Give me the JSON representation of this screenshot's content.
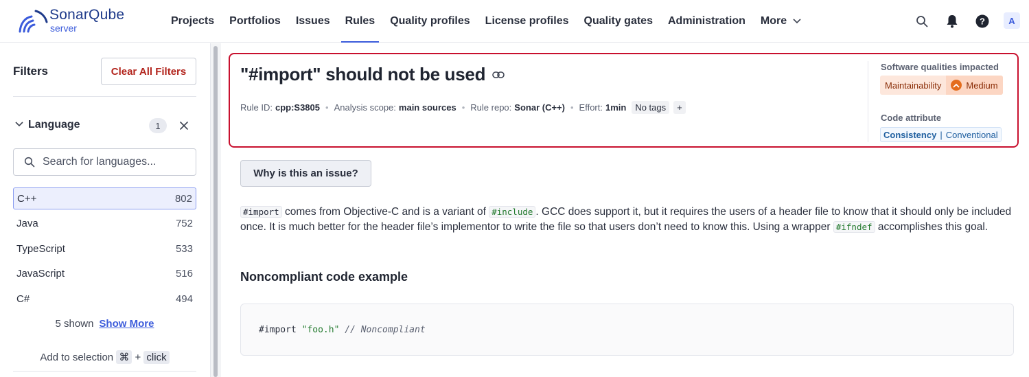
{
  "logo": {
    "name": "SonarQube",
    "subtitle": "server"
  },
  "nav": {
    "items": [
      "Projects",
      "Portfolios",
      "Issues",
      "Rules",
      "Quality profiles",
      "License profiles",
      "Quality gates",
      "Administration",
      "More"
    ],
    "active": "Rules"
  },
  "top_icons": [
    "search-icon",
    "bell-icon",
    "help-icon"
  ],
  "avatar": "A",
  "sidebar": {
    "title": "Filters",
    "clear_all": "Clear All Filters",
    "language": {
      "title": "Language",
      "count": "1",
      "search_placeholder": "Search for languages...",
      "items": [
        {
          "name": "C++",
          "count": "802",
          "selected": true
        },
        {
          "name": "Java",
          "count": "752",
          "selected": false
        },
        {
          "name": "TypeScript",
          "count": "533",
          "selected": false
        },
        {
          "name": "JavaScript",
          "count": "516",
          "selected": false
        },
        {
          "name": "C#",
          "count": "494",
          "selected": false
        }
      ],
      "shown": "5 shown",
      "show_more": "Show More",
      "add_to_selection": "Add to selection",
      "shortcut_key": "⌘",
      "shortcut_plus": "+",
      "shortcut_click": "click"
    }
  },
  "rule": {
    "title": "\"#import\" should not be used",
    "rule_id_label": "Rule ID:",
    "rule_id": "cpp:S3805",
    "scope_label": "Analysis scope:",
    "scope": "main sources",
    "repo_label": "Rule repo:",
    "repo": "Sonar (C++)",
    "effort_label": "Effort:",
    "effort": "1min",
    "tags": "No tags",
    "add_tag": "+",
    "software_qualities_title": "Software qualities impacted",
    "quality": "Maintainability",
    "severity": "Medium",
    "code_attribute_title": "Code attribute",
    "attribute": "Consistency",
    "attribute_sub": "Conventional",
    "colors": {
      "highlight_border": "#c8102e",
      "severity_medium": "#e46c1c",
      "accent": "#3b5bdb"
    }
  },
  "why_button": "Why is this an issue?",
  "description": {
    "code1": "#import",
    "text1": " comes from Objective-C and is a variant of ",
    "code2": "#include",
    "text2": ". GCC does support it, but it requires the users of a header file to know that it should only be included once. It is much better for the header file’s implementor to write the file so that users don’t need to know this. Using a wrapper ",
    "code3": "#ifndef",
    "text3": " accomplishes this goal."
  },
  "noncompliant": {
    "title": "Noncompliant code example",
    "keyword": "#import",
    "string": "\"foo.h\"",
    "comment": "// Noncompliant"
  }
}
